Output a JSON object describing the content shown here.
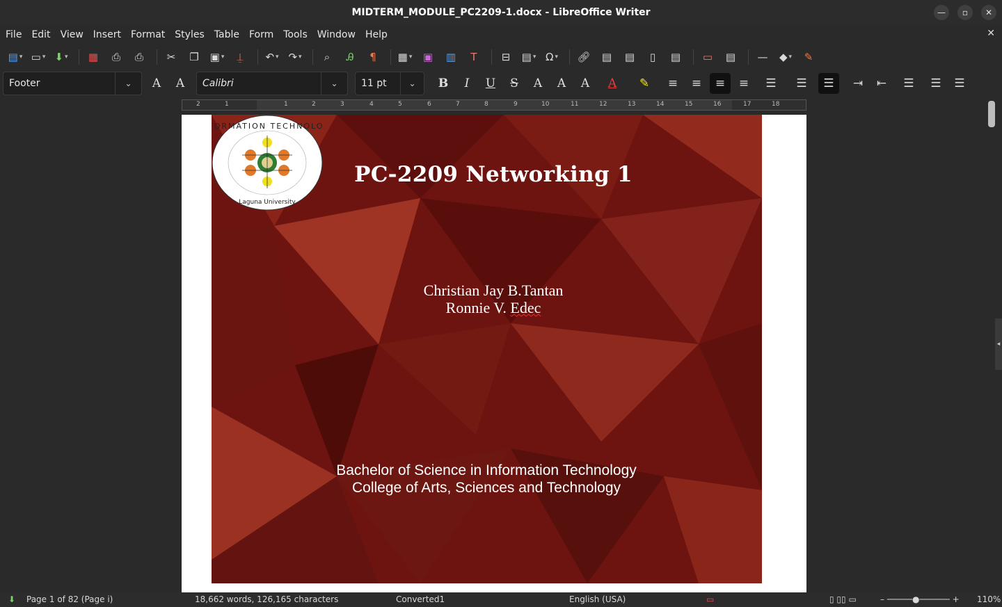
{
  "window": {
    "title": "MIDTERM_MODULE_PC2209-1.docx - LibreOffice Writer"
  },
  "menu": [
    "File",
    "Edit",
    "View",
    "Insert",
    "Format",
    "Styles",
    "Table",
    "Form",
    "Tools",
    "Window",
    "Help"
  ],
  "toolbar2": {
    "paragraph_style": "Footer",
    "font_name": "Calibri",
    "font_size": "11 pt"
  },
  "ruler": {
    "ticks": [
      "2",
      "1",
      "1",
      "2",
      "3",
      "4",
      "5",
      "6",
      "7",
      "8",
      "9",
      "10",
      "11",
      "12",
      "13",
      "14",
      "15",
      "16",
      "17",
      "18"
    ]
  },
  "document": {
    "title": "PC-2209 Networking 1",
    "author1": "Christian Jay B.Tantan",
    "author2_first": "Ronnie V. ",
    "author2_last": "Edec",
    "seal_top_text": "INFORMATION TECHNOLOGY",
    "seal_bottom_text": "Laguna University",
    "degree": "Bachelor of Science in Information Technology",
    "college": "College of Arts, Sciences and Technology"
  },
  "status": {
    "page": "Page 1 of 82 (Page i)",
    "words": "18,662 words, 126,165 characters",
    "page_style": "Converted1",
    "language": "English (USA)",
    "zoom": "110%"
  },
  "colors": {
    "cover_background": "#6e1410",
    "spellcheck_underline": "#dd3333"
  }
}
